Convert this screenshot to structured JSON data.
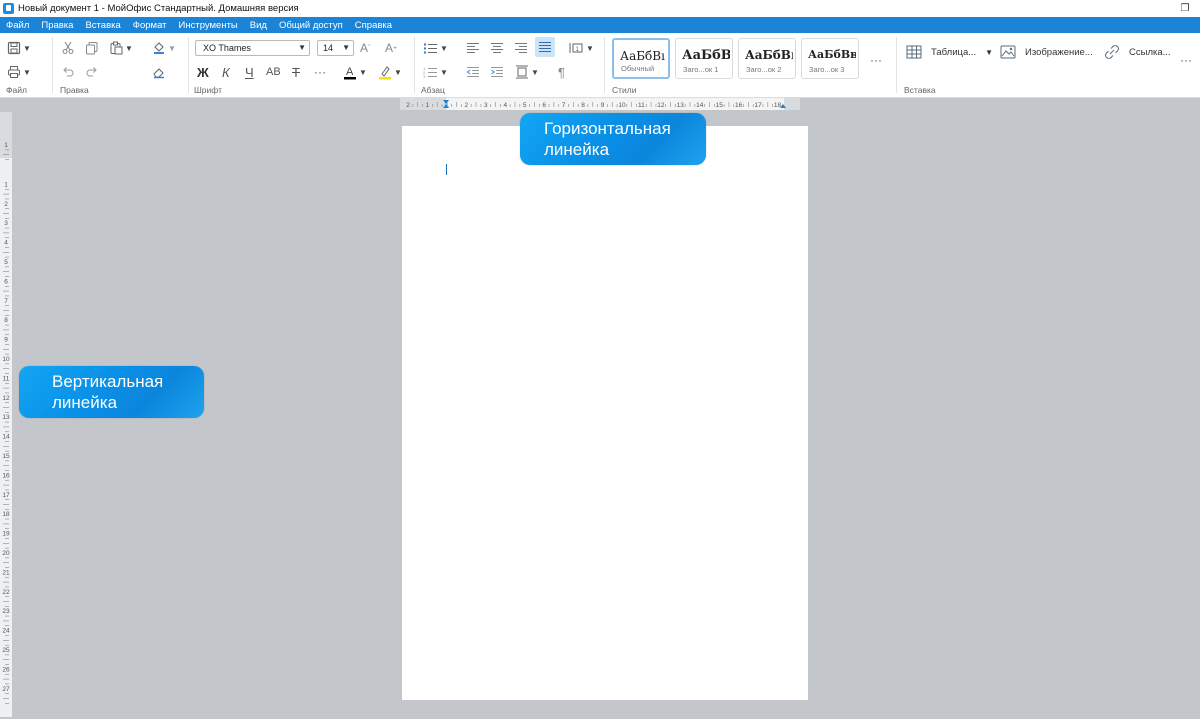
{
  "window": {
    "title": "Новый документ 1 - МойОфис Стандартный. Домашняя версия",
    "maximize_glyph": "❐",
    "close_glyph": "✕"
  },
  "menu": [
    "Файл",
    "Правка",
    "Вставка",
    "Формат",
    "Инструменты",
    "Вид",
    "Общий доступ",
    "Справка"
  ],
  "ribbon": {
    "groups": {
      "file": "Файл",
      "edit": "Правка",
      "font": "Шрифт",
      "paragraph": "Абзац",
      "styles": "Стили",
      "insert": "Вставка"
    },
    "font_name": "XO Thames",
    "font_size": "14",
    "format_buttons": {
      "bold": "Ж",
      "italic": "К",
      "underline": "Ч",
      "caps": "АВ",
      "strike": "Т",
      "more": "···"
    },
    "styles": [
      {
        "preview": "АаБбВı",
        "name": "Обычный",
        "selected": true,
        "bold": false
      },
      {
        "preview": "АаБбВ",
        "name": "Заго...ок 1",
        "selected": false,
        "bold": true
      },
      {
        "preview": "АаБбВı",
        "name": "Заго...ок 2",
        "selected": false,
        "bold": true
      },
      {
        "preview": "АаБбВв",
        "name": "Заго...ок 3",
        "selected": false,
        "bold": true
      }
    ],
    "styles_more": "···",
    "insert": {
      "table": "Таблица...",
      "image": "Изображение...",
      "link": "Ссылка...",
      "more": "···"
    }
  },
  "rulers": {
    "horizontal_labels": [
      "2",
      "1",
      "1",
      "2",
      "3",
      "4",
      "5",
      "6",
      "7",
      "8",
      "9",
      "10",
      "11",
      "12",
      "13",
      "14",
      "15",
      "16",
      "17",
      "18"
    ],
    "vertical_labels": [
      "1",
      "1",
      "2",
      "3",
      "4",
      "5",
      "6",
      "7",
      "8",
      "9",
      "10",
      "11",
      "12",
      "13",
      "14",
      "15",
      "16",
      "17",
      "18",
      "19",
      "20",
      "21",
      "22",
      "23",
      "24",
      "25",
      "26",
      "27"
    ]
  },
  "callouts": {
    "horizontal": [
      "Горизонтальная",
      "линейка"
    ],
    "vertical": [
      "Вертикальная",
      "линейка"
    ]
  },
  "colors": {
    "menubar": "#1c84d6",
    "workspace": "#c3c7cb",
    "callout": "#0a8fe6",
    "text_color_bar": "#000000",
    "highlight_bar": "#f5e400"
  }
}
